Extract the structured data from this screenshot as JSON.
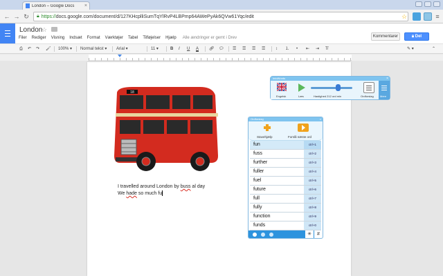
{
  "browser": {
    "tab_title": "London – Google Docs",
    "tab_close": "×",
    "url_scheme": "https://",
    "url_rest": "docs.google.com/document/d/127KHcplliSumTqYlRvP4LBPmp64AWePyAk6QVw61Yqc/edit"
  },
  "doc_header": {
    "title": "London",
    "star": "☆",
    "user_email": "",
    "menu": [
      "Filer",
      "Rediger",
      "Visning",
      "Indsæt",
      "Format",
      "Værktøjer",
      "Tabel",
      "Tilføjelser",
      "Hjælp"
    ],
    "save_status": "Alle ændringer er gemt i Drev",
    "comment_label": "Kommentarer",
    "share_label": "Del"
  },
  "toolbar": {
    "zoom": "100%",
    "style": "Normal tekst",
    "font": "Arial",
    "size": "11",
    "bold": "B",
    "italic": "I",
    "underline": "U",
    "text_color": "A"
  },
  "document": {
    "line1_a": "I travelled around London by ",
    "line1_err": "buss",
    "line1_b": " al day",
    "line2_a": "We ",
    "line2_err": "hade",
    "line2_b": " so much fu"
  },
  "intowords": {
    "header": "IntoWords",
    "close": "×",
    "lang_label": "Engelsk",
    "play_label": "Læs",
    "speed_label": "Hastighed 212 ord min",
    "predict_label": "Ordforslag",
    "more_label": "Mere",
    "speed_wpm": 212
  },
  "ordforslag": {
    "header": "Ordforslag",
    "close": "×",
    "spell_label": "Stavehjælp",
    "predict_label": "Forslå næste ord",
    "words": [
      {
        "word": "fun",
        "shortcut": "ctrl+1"
      },
      {
        "word": "fuss",
        "shortcut": "ctrl+2"
      },
      {
        "word": "further",
        "shortcut": "ctrl+3"
      },
      {
        "word": "fuller",
        "shortcut": "ctrl+4"
      },
      {
        "word": "fuel",
        "shortcut": "ctrl+5"
      },
      {
        "word": "future",
        "shortcut": "ctrl+6"
      },
      {
        "word": "full",
        "shortcut": "ctrl+7"
      },
      {
        "word": "fully",
        "shortcut": "ctrl+8"
      },
      {
        "word": "function",
        "shortcut": "ctrl+9"
      },
      {
        "word": "funds",
        "shortcut": "ctrl+0"
      }
    ],
    "footer_settings": "✳",
    "footer_hash": "#"
  },
  "colors": {
    "accent_blue": "#4285f4",
    "share_blue": "#4d90fe",
    "intowords_blue": "#7fc4ef",
    "orange": "#f0a21c",
    "bus_red": "#d32b1f"
  }
}
